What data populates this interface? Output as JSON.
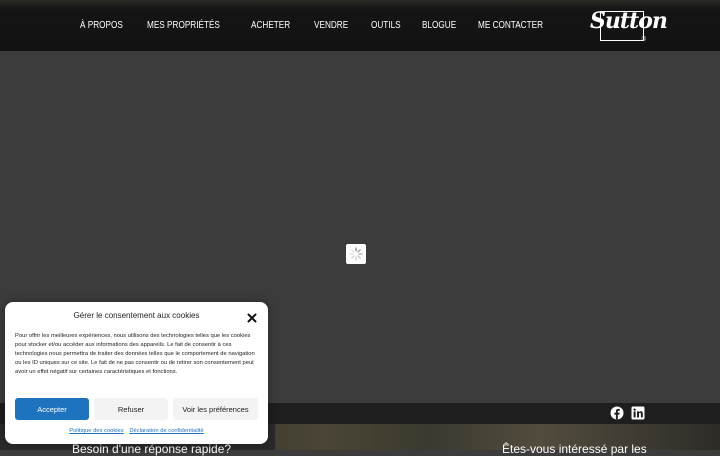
{
  "header": {
    "nav": [
      "À PROPOS",
      "MES PROPRIÉTÉS",
      "ACHETER",
      "VENDRE",
      "OUTILS",
      "BLOGUE",
      "ME CONTACTER"
    ],
    "logo_text": "Sutton",
    "logo_reg": "®"
  },
  "social": {
    "icons": [
      "facebook-icon",
      "linkedin-icon"
    ]
  },
  "bottom": {
    "left_text": "Besoin d'une réponse rapide?",
    "right_text": "Êtes-vous intéressé par les"
  },
  "cookie": {
    "title": "Gérer le consentement aux cookies",
    "body": "Pour offrir les meilleures expériences, nous utilisons des technologies telles que les cookies pour stocker et/ou accéder aux informations des appareils. Le fait de consentir à ces technologies nous permettra de traiter des données telles que le comportement de navigation ou les ID uniques sur ce site. Le fait de ne pas consentir ou de retirer son consentement peut avoir un effet négatif sur certaines caractéristiques et fonctions.",
    "accept": "Accepter",
    "refuse": "Refuser",
    "preferences": "Voir les préférences",
    "policy_link": "Politique des cookies",
    "privacy_link": "Déclaration de confidentialité"
  },
  "colors": {
    "accent": "#1e73be",
    "header_bg": "#121212",
    "main_bg": "#3c3c3c"
  }
}
